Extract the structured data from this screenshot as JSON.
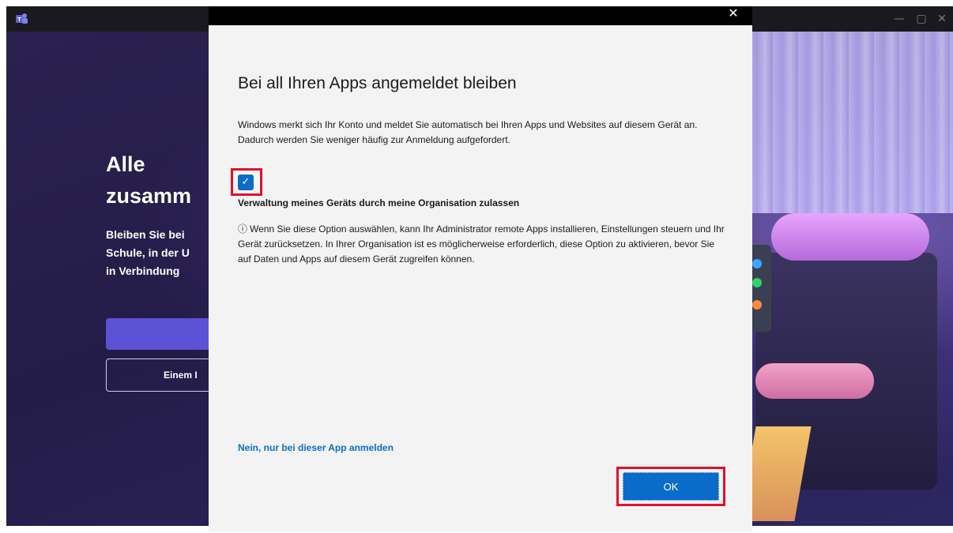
{
  "app": {
    "icon": "teams-icon",
    "window_controls": {
      "minimize": "—",
      "maximize": "▢",
      "close": "✕"
    },
    "hero": {
      "title": "Alle\nzusamm",
      "subtitle": "Bleiben Sie bei\nSchule, in der U\nin Verbindung",
      "secondary_button": "Einem I"
    }
  },
  "dialog": {
    "close_glyph": "✕",
    "title": "Bei all Ihren Apps angemeldet bleiben",
    "description": "Windows merkt sich Ihr Konto und meldet Sie automatisch bei Ihren Apps und Websites auf diesem Gerät an. Dadurch werden Sie weniger häufig zur Anmeldung aufgefordert.",
    "checkbox": {
      "checked": true,
      "glyph": "✓",
      "label": "Verwaltung meines Geräts durch meine Organisation zulassen"
    },
    "info_icon": "ⓘ",
    "info_text": "Wenn Sie diese Option auswählen, kann Ihr Administrator remote Apps installieren, Einstellungen steuern und Ihr Gerät zurücksetzen. In Ihrer Organisation ist es möglicherweise erforderlich, diese Option zu aktivieren, bevor Sie auf Daten und Apps auf diesem Gerät zugreifen können.",
    "secondary_link": "Nein, nur bei dieser App anmelden",
    "ok_label": "OK"
  },
  "colors": {
    "accent": "#0a6cc9",
    "highlight": "#e2102a",
    "dialog_bg": "#f3f3f3"
  }
}
